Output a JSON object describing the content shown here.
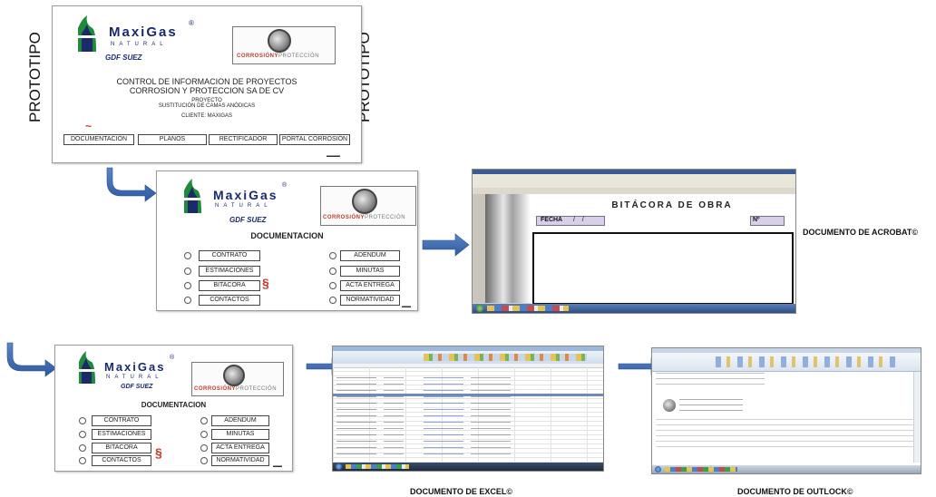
{
  "side_label": "PROTOTIPO",
  "logo": {
    "name": "MaxiGas",
    "sub": "NATURAL",
    "reg": "®",
    "suez": "GDF SUEZ"
  },
  "cp_logo": {
    "part1": "CORROSIÓN",
    "part2": "Y",
    "part3": "PROTECCIÓN"
  },
  "main_panel": {
    "title_line1": "CONTROL DE INFORMACION DE PROYECTOS",
    "title_line2": "CORROSION Y PROTECCION SA DE CV",
    "proyecto_label": "PROYECTO",
    "proyecto_value": "SUSTITUCIÓN DE CAMAS ANÓDICAS",
    "cliente": "CLIENTE:  MAXIGAS",
    "buttons": [
      "DOCUMENTACIÓN",
      "PLANOS",
      "RECTIFICADOR",
      "PORTAL CORROSIÓN"
    ]
  },
  "doc_panel": {
    "heading": "DOCUMENTACION",
    "left_items": [
      "CONTRATO",
      "ESTIMACIONES",
      "BITACORA",
      "CONTACTOS"
    ],
    "right_items": [
      "ADENDUM",
      "MINUTAS",
      "ACTA ENTREGA",
      "NORMATIVIDAD"
    ]
  },
  "acrobat": {
    "doc_title": "BITÁCORA DE OBRA",
    "fecha": "FECHA",
    "num": "Nº",
    "caption": "DOCUMENTO DE ACROBAT©"
  },
  "excel": {
    "caption": "DOCUMENTO DE EXCEL©"
  },
  "outlook": {
    "caption": "DOCUMENTO DE OUTLOCK©"
  },
  "colors": {
    "arrow": "#3f6db3",
    "logo_green": "#1f8a3a",
    "logo_blue": "#1a2a6a",
    "cp_red": "#c0392b"
  }
}
